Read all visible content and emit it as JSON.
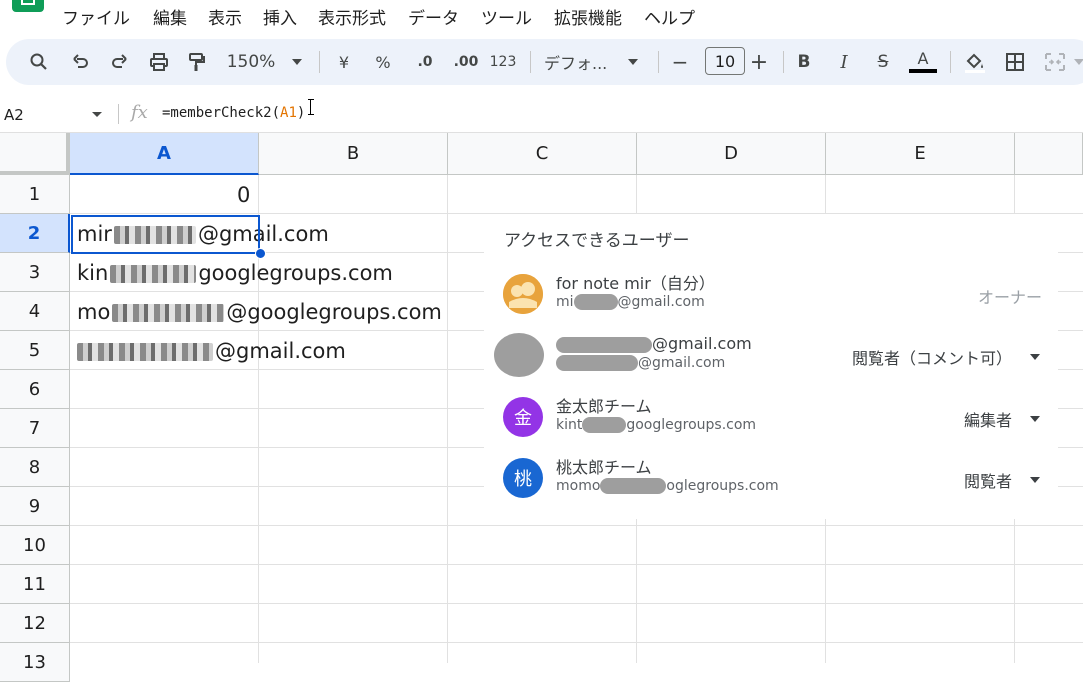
{
  "menu": [
    "ファイル",
    "編集",
    "表示",
    "挿入",
    "表示形式",
    "データ",
    "ツール",
    "拡張機能",
    "ヘルプ"
  ],
  "toolbar": {
    "zoom": "150%",
    "currency": "¥",
    "percent": "%",
    "dec_minus": ".0",
    "dec_plus": ".00",
    "number_format": "123",
    "font": "デフォ...",
    "minus": "−",
    "font_size": "10",
    "plus": "+",
    "bold": "B",
    "italic": "I",
    "strike": "S",
    "text_color": "A",
    "text_color_hex": "#000000"
  },
  "formula_bar": {
    "name_box": "A2",
    "fx": "fx",
    "formula_prefix": "=memberCheck2(",
    "formula_ref": "A1",
    "formula_suffix": ")"
  },
  "grid": {
    "columns": [
      "A",
      "B",
      "C",
      "D",
      "E"
    ],
    "selected_column": "A",
    "rows": [
      "1",
      "2",
      "3",
      "4",
      "5",
      "6",
      "7",
      "8",
      "9",
      "10",
      "11",
      "12",
      "13"
    ],
    "selected_row": "2",
    "selected_cell": "A2",
    "cells": {
      "A1": "0",
      "A2_prefix": "mir",
      "A2_suffix": "@gmail.com",
      "A3_prefix": "kin",
      "A3_suffix": "googlegroups.com",
      "A4_prefix": "mo",
      "A4_suffix": "@googlegroups.com",
      "A5_prefix": "",
      "A5_suffix": "@gmail.com"
    }
  },
  "access_panel": {
    "title": "アクセスできるユーザー",
    "users": [
      {
        "name": "for note mir（自分）",
        "email_prefix": "mi",
        "email_suffix": "@gmail.com",
        "role": "オーナー",
        "avatar": "photo",
        "avatar_color": "#e8a33c"
      },
      {
        "name": "@gmail.com",
        "email_prefix": "",
        "email_suffix": "@gmail.com",
        "role": "閲覧者（コメント可）",
        "avatar": "blurred",
        "avatar_color": "#9e9e9e"
      },
      {
        "name": "金太郎チーム",
        "email_prefix": "kint",
        "email_suffix": "googlegroups.com",
        "role": "編集者",
        "avatar": "金",
        "avatar_color": "#9334e6"
      },
      {
        "name": "桃太郎チーム",
        "email_prefix": "momo",
        "email_suffix": "oglegroups.com",
        "role": "閲覧者",
        "avatar": "桃",
        "avatar_color": "#1967d2"
      }
    ]
  }
}
